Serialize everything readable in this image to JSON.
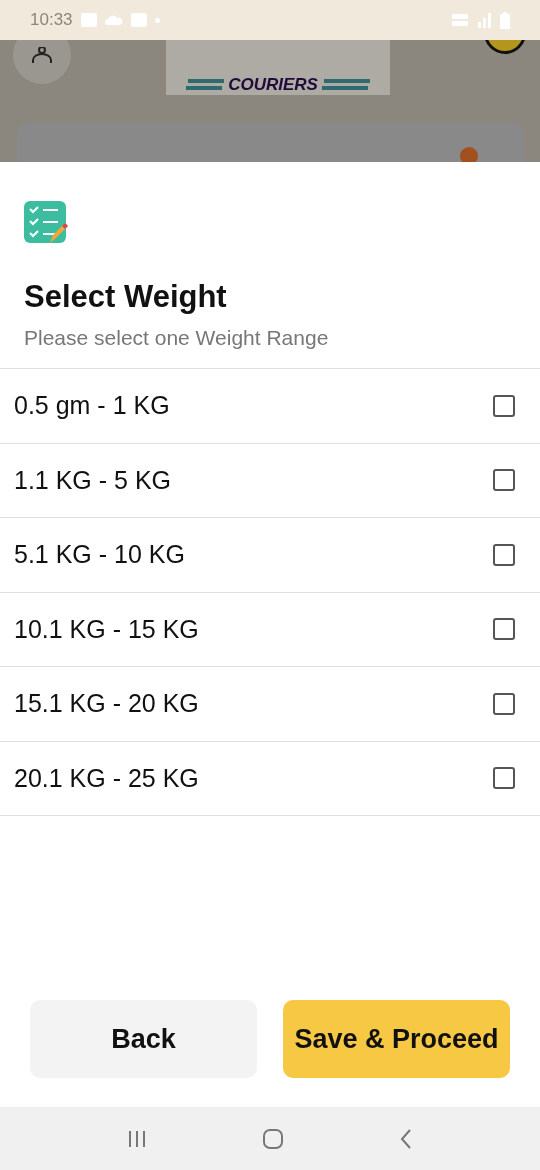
{
  "status_bar": {
    "time": "10:33"
  },
  "background": {
    "logo_text": "COURIERS"
  },
  "sheet": {
    "title": "Select Weight",
    "subtitle": "Please select one Weight Range",
    "options": [
      {
        "label": "0.5 gm - 1 KG",
        "checked": false
      },
      {
        "label": "1.1 KG - 5 KG",
        "checked": false
      },
      {
        "label": "5.1 KG - 10 KG",
        "checked": false
      },
      {
        "label": "10.1 KG - 15 KG",
        "checked": false
      },
      {
        "label": "15.1 KG - 20 KG",
        "checked": false
      },
      {
        "label": "20.1 KG - 25 KG",
        "checked": false
      }
    ],
    "buttons": [
      {
        "label": "Back",
        "kind": "secondary"
      },
      {
        "label": "Save & Proceed",
        "kind": "primary"
      }
    ]
  }
}
